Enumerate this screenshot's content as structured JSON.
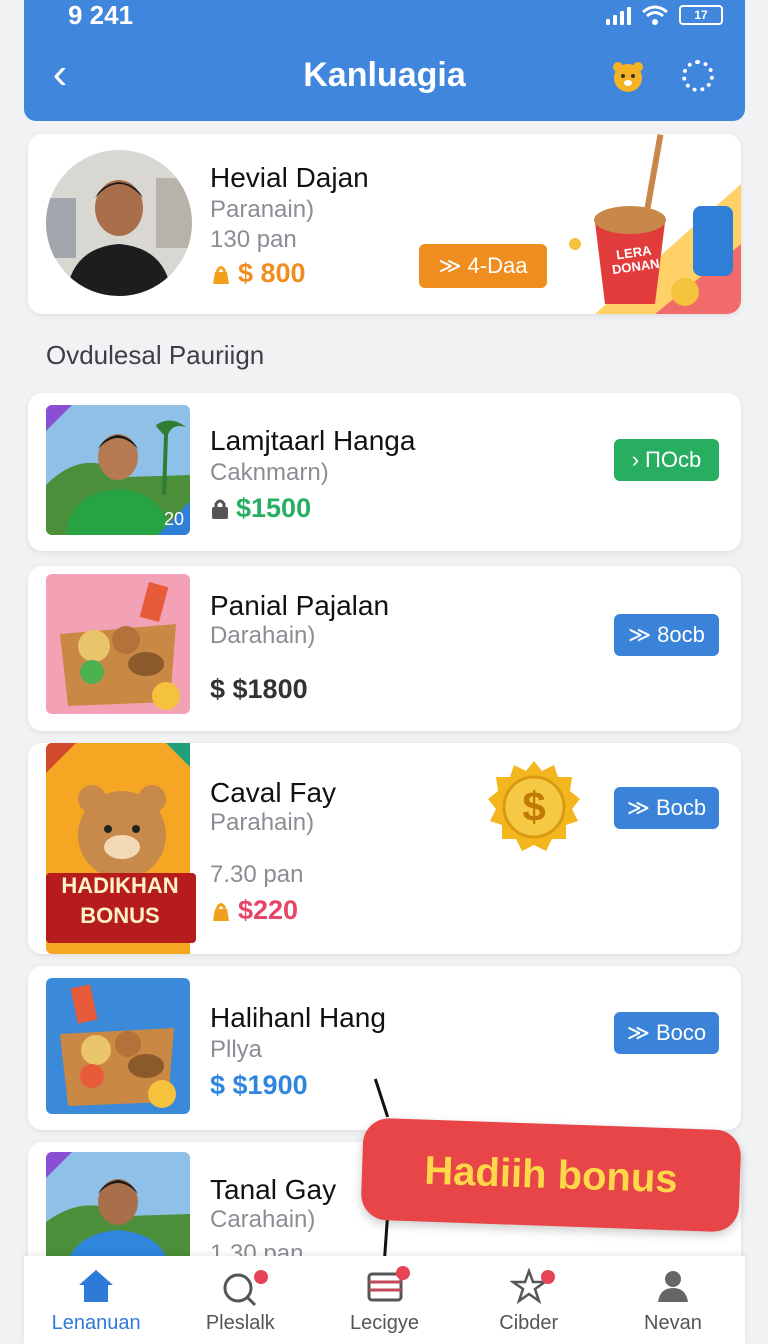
{
  "status": {
    "time": "9 241",
    "battery": "17"
  },
  "header": {
    "title": "Kanluagia"
  },
  "featured": {
    "name": "Hevial Dajan",
    "subtitle": "Paranain)",
    "meta": "130 pan",
    "price": "$ 800",
    "chip": "4-Daa",
    "promo_text_1": "LERA",
    "promo_text_2": "DONAN"
  },
  "section": {
    "title": "Ovdulesal Pauriign"
  },
  "items": [
    {
      "name": "Lamjtaarl Hanga",
      "subtitle": "Caknmarn)",
      "price": "$1500",
      "chip": "ΠOcb",
      "badge": "20"
    },
    {
      "name": "Panial Pajalan",
      "subtitle": "Darahain)",
      "price": "$ $1800",
      "chip": "8ocb"
    },
    {
      "name": "Caval Fay",
      "subtitle": "Parahain)",
      "meta": "7.30 pan",
      "price": "$220",
      "chip": "Bocb",
      "banner_1": "HADIKHAN",
      "banner_2": "BONUS",
      "coin_symbol": "$"
    },
    {
      "name": "Halihanl Hang",
      "subtitle": "Pllya",
      "price": "$ $1900",
      "chip": "Boco"
    },
    {
      "name": "Tanal Gay",
      "subtitle": "Carahain)",
      "meta": "1 30 pan"
    }
  ],
  "callout": {
    "text": "Hadiih bonus"
  },
  "nav": [
    {
      "label": "Lenanuan",
      "icon": "home-icon",
      "active": true
    },
    {
      "label": "Pleslalk",
      "icon": "search-icon"
    },
    {
      "label": "Lecigye",
      "icon": "list-icon"
    },
    {
      "label": "Cibder",
      "icon": "star-icon"
    },
    {
      "label": "Nevan",
      "icon": "profile-icon"
    }
  ],
  "colors": {
    "primary": "#3f86dc",
    "green": "#27ae60",
    "orange": "#f08d1f",
    "red": "#e84548",
    "price_orange": "#f08d1f",
    "price_green": "#27ae60",
    "price_pink": "#e84566",
    "price_blue": "#2f86dc"
  }
}
